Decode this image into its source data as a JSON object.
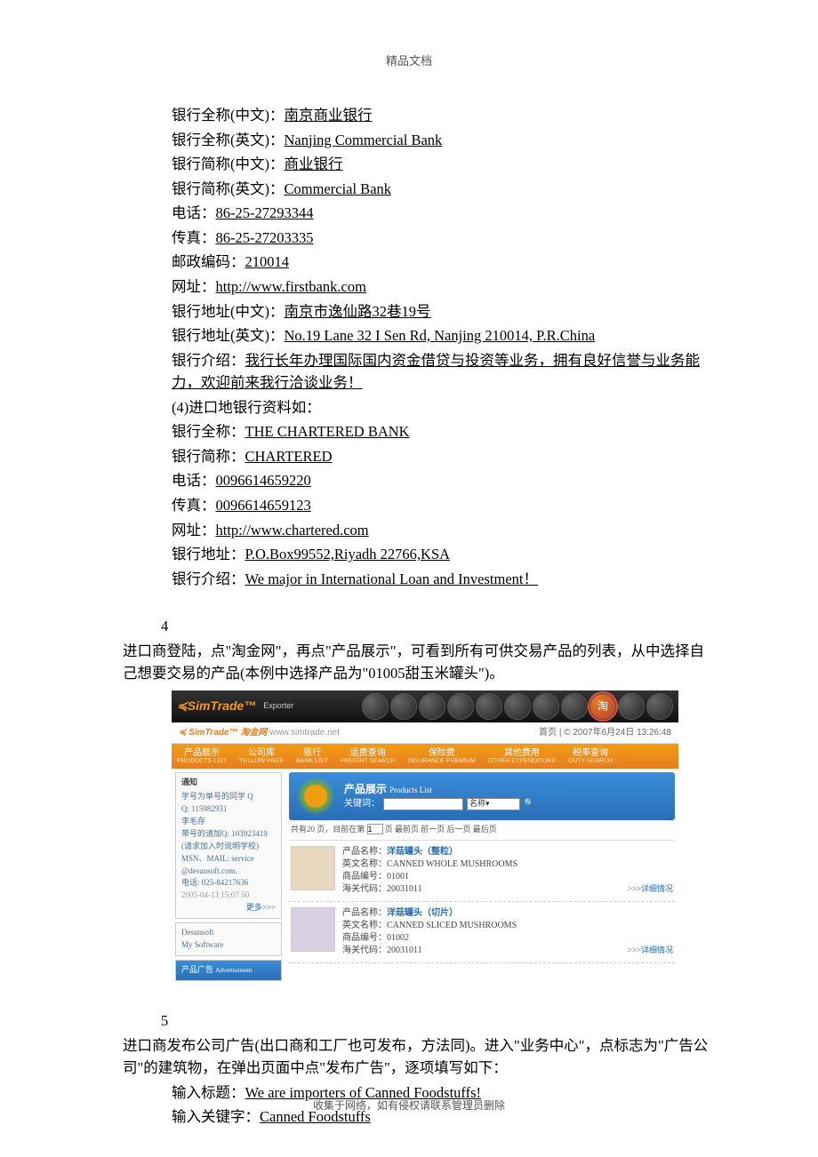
{
  "header": "精品文档",
  "footer": "收集于网络，如有侵权请联系管理员删除",
  "bank_cn": {
    "full_name_label": "银行全称(中文)：",
    "full_name": "南京商业银行",
    "full_name_en_label": "银行全称(英文)：",
    "full_name_en": "Nanjing Commercial Bank",
    "short_name_label": "银行简称(中文)：",
    "short_name": "商业银行",
    "short_name_en_label": "银行简称(英文)：",
    "short_name_en": "Commercial Bank",
    "phone_label": "电话：",
    "phone": "86-25-27293344",
    "fax_label": "传真：",
    "fax": "86-25-27203335",
    "zip_label": "邮政编码：",
    "zip": "210014",
    "url_label": "网址：",
    "url": "http://www.firstbank.com",
    "addr_cn_label": "银行地址(中文)：",
    "addr_cn": "南京市逸仙路32巷19号",
    "addr_en_label": "银行地址(英文)：",
    "addr_en": "No.19 Lane 32 I Sen Rd, Nanjing 210014, P.R.China",
    "intro_label": "银行介绍：",
    "intro": "我行长年办理国际国内资金借贷与投资等业务，拥有良好信誉与业务能力，欢迎前来我行洽谈业务！"
  },
  "import_intro": "(4)进口地银行资料如：",
  "bank_import": {
    "full_name_label": "银行全称：",
    "full_name": "THE CHARTERED BANK",
    "short_name_label": "银行简称：",
    "short_name": "CHARTERED",
    "phone_label": "电话：",
    "phone": "0096614659220",
    "fax_label": "传真：",
    "fax": "0096614659123",
    "url_label": "网址：",
    "url": "http://www.chartered.com",
    "addr_label": "银行地址：",
    "addr": "P.O.Box99552,Riyadh 22766,KSA",
    "intro_label": "银行介绍：",
    "intro": "We major in International Loan and Investment！"
  },
  "sect4": {
    "num": "4",
    "text": "进口商登陆，点\"淘金网\"，再点\"产品展示\"，可看到所有可供交易产品的列表，从中选择自己想要交易的产品(本例中选择产品为\"01005甜玉米罐头\")。"
  },
  "screenshot": {
    "logo": "≼SimTrade™",
    "logo_sub": "Exporter",
    "subheader_left": "≼ SimTrade™ 淘金网",
    "subheader_url": "www.simtrade.net",
    "subheader_right_home": "首页",
    "subheader_right_time": "2007年6月24日 13:26:48",
    "menu": [
      {
        "cn": "产品展示",
        "en": "PRODUCTS LIST"
      },
      {
        "cn": "公司库",
        "en": "YELLOW PAGE"
      },
      {
        "cn": "银行",
        "en": "BANK LIST"
      },
      {
        "cn": "运费查询",
        "en": "FREIGHT SEARCH"
      },
      {
        "cn": "保险费",
        "en": "INSURANCE PREMIUM"
      },
      {
        "cn": "其他费用",
        "en": "OTHER EXPENDITURE"
      },
      {
        "cn": "税率查询",
        "en": "DUTY SEARCH"
      }
    ],
    "sidebar_notice_title": "通知",
    "sidebar_notice_name": "李毛存",
    "sidebar_notice_q1": "Q: 115982931",
    "sidebar_notice_q2": "带号的请加Q: 103923419",
    "sidebar_notice_note": "(请求加入时说明学校)",
    "sidebar_notice_mail": "MSN、MAIL: service",
    "sidebar_notice_domain": "@desunsoft.com.",
    "sidebar_notice_tel": "电话: 025-84217636",
    "sidebar_notice_date": "2005-04-13 15:07:50",
    "sidebar_more": "更多>>>",
    "sidebar_soft": "Desunsoft",
    "sidebar_soft2": "My Software",
    "sidebar_ad_title": "产品广告",
    "sidebar_ad_en": "Advertisement",
    "banner_title": "产品展示",
    "banner_title_en": "Products List",
    "banner_keyword": "关键词：",
    "banner_select": "名称",
    "pager_text_1": "共有20 页，目前在第",
    "pager_page": "1",
    "pager_text_2": "页 最前页 前一页 后一页 最后页",
    "prod1_name_label": "产品名称：",
    "prod1_name": "洋菇罐头（整粒）",
    "prod1_en_label": "英文名称：",
    "prod1_en": "CANNED WHOLE MUSHROOMS",
    "prod1_code_label": "商品编号：",
    "prod1_code": "01001",
    "prod1_hs_label": "海关代码：",
    "prod1_hs": "20031011",
    "prod2_name": "洋菇罐头（切片）",
    "prod2_en": "CANNED SLICED MUSHROOMS",
    "prod2_code": "01002",
    "prod2_hs": "20031011",
    "detail_link": ">>>详细情况"
  },
  "sect5": {
    "num": "5",
    "text": "进口商发布公司广告(出口商和工厂也可发布，方法同)。进入\"业务中心\"，点标志为\"广告公司\"的建筑物，在弹出页面中点\"发布广告\"，逐项填写如下：",
    "title_label": "输入标题：",
    "title_val": "We are importers of Canned Foodstuffs!",
    "keyword_label": "输入关键字：",
    "keyword_val": "Canned Foodstuffs"
  }
}
